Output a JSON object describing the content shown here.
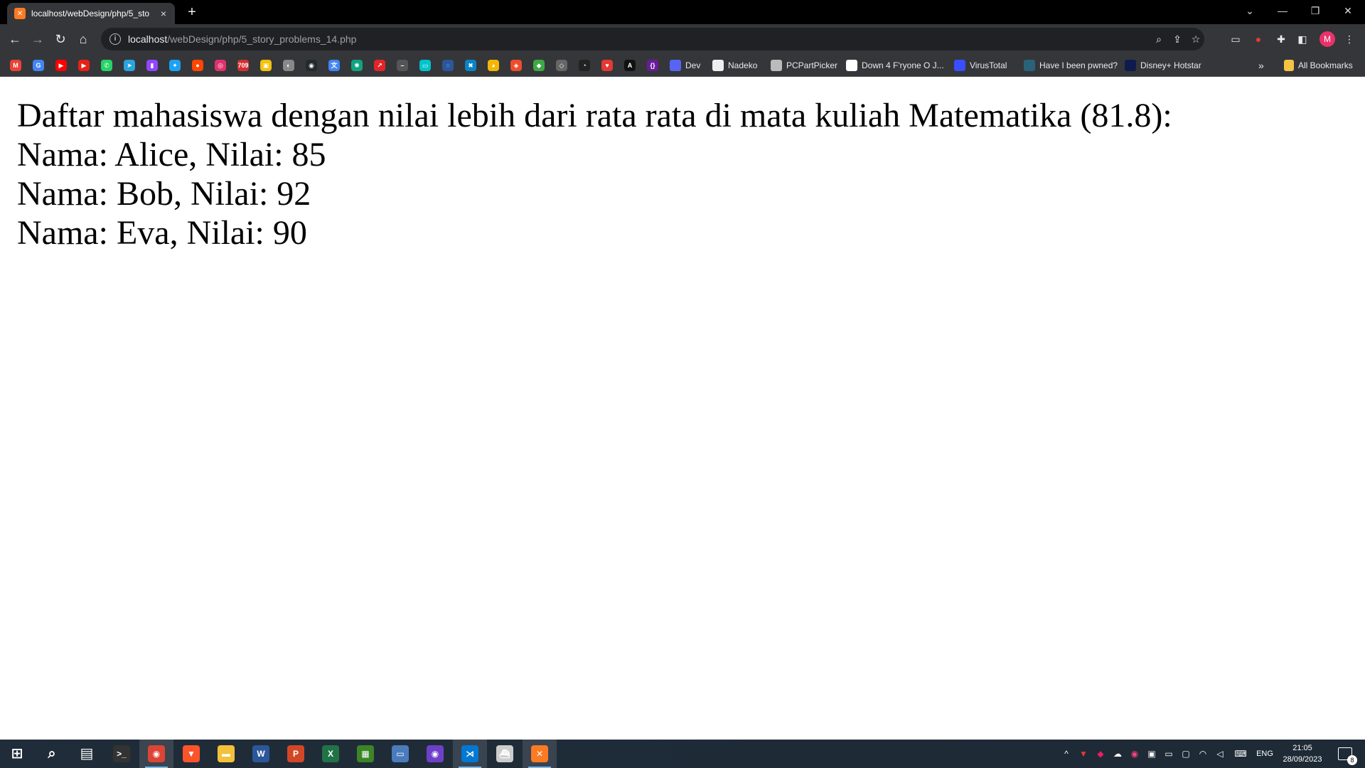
{
  "window": {
    "tab_title": "localhost/webDesign/php/5_sto",
    "tab_close": "×",
    "new_tab": "+",
    "minimize": "—",
    "restore": "❐",
    "close": "✕",
    "tab_search": "⌄"
  },
  "toolbar": {
    "back": "←",
    "forward": "→",
    "reload": "↻",
    "home": "⌂",
    "url_host": "localhost",
    "url_path": "/webDesign/php/5_story_problems_14.php",
    "profile_initial": "M"
  },
  "bookmarks": {
    "icons": [
      {
        "name": "gmail",
        "glyph": "M",
        "color": "#ea4335"
      },
      {
        "name": "google",
        "glyph": "G",
        "color": "#4285f4"
      },
      {
        "name": "youtube",
        "glyph": "▶",
        "color": "#ff0000"
      },
      {
        "name": "youtube-music",
        "glyph": "▶",
        "color": "#e62117"
      },
      {
        "name": "whatsapp",
        "glyph": "✆",
        "color": "#25d366"
      },
      {
        "name": "telegram",
        "glyph": "➤",
        "color": "#2aa3df"
      },
      {
        "name": "twitch",
        "glyph": "▮",
        "color": "#9146ff"
      },
      {
        "name": "twitter",
        "glyph": "✦",
        "color": "#1da1f2"
      },
      {
        "name": "reddit",
        "glyph": "●",
        "color": "#ff4500"
      },
      {
        "name": "instagram",
        "glyph": "◎",
        "color": "#e1306c"
      },
      {
        "name": "1709",
        "glyph": "709",
        "color": "#d32f2f"
      },
      {
        "name": "photo",
        "glyph": "▣",
        "color": "#f4c20d"
      },
      {
        "name": "anime",
        "glyph": "◐",
        "color": "#888888"
      },
      {
        "name": "github",
        "glyph": "◉",
        "color": "#24292e"
      },
      {
        "name": "translate",
        "glyph": "文",
        "color": "#4285f4"
      },
      {
        "name": "chatgpt",
        "glyph": "✺",
        "color": "#10a37f"
      },
      {
        "name": "zoho",
        "glyph": "↗",
        "color": "#e42527"
      },
      {
        "name": "dash",
        "glyph": "–",
        "color": "#555555"
      },
      {
        "name": "canva",
        "glyph": "▭",
        "color": "#00c4cc"
      },
      {
        "name": "quill",
        "glyph": "◌",
        "color": "#2b579a"
      },
      {
        "name": "vscode-web",
        "glyph": "✖",
        "color": "#0a84c6"
      },
      {
        "name": "bear",
        "glyph": "◕",
        "color": "#f2b705"
      },
      {
        "name": "shopping",
        "glyph": "◈",
        "color": "#ee4d2d"
      },
      {
        "name": "mobile-legends",
        "glyph": "◆",
        "color": "#3da944"
      },
      {
        "name": "roblox",
        "glyph": "◇",
        "color": "#666666"
      },
      {
        "name": "speedtest",
        "glyph": "◔",
        "color": "#222222"
      },
      {
        "name": "heart",
        "glyph": "♥",
        "color": "#e53935"
      },
      {
        "name": "bracket-a",
        "glyph": "A",
        "color": "#111111"
      },
      {
        "name": "bracket-b",
        "glyph": "{}",
        "color": "#6a1b9a"
      }
    ],
    "labelled": [
      {
        "name": "dev",
        "label": "Dev",
        "color": "#5865f2"
      },
      {
        "name": "nadeko",
        "label": "Nadeko",
        "color": "#eeeeee"
      },
      {
        "name": "pcpartpicker",
        "label": "PCPartPicker",
        "color": "#bbbbbb"
      },
      {
        "name": "down4",
        "label": "Down 4 F'ryone O J...",
        "color": "#ffffff"
      },
      {
        "name": "virustotal",
        "label": "VirusTotal",
        "color": "#394eff"
      },
      {
        "name": "hibp",
        "label": "Have I been pwned?",
        "color": "#2a6379"
      },
      {
        "name": "hotstar",
        "label": "Disney+ Hotstar",
        "color": "#0f1b4d"
      }
    ],
    "overflow": "»",
    "all_bookmarks": "All Bookmarks"
  },
  "page": {
    "heading": "Daftar mahasiswa dengan nilai lebih dari rata rata di mata kuliah Matematika (81.8):",
    "rows": [
      "Nama: Alice, Nilai: 85",
      "Nama: Bob, Nilai: 92",
      "Nama: Eva, Nilai: 90"
    ]
  },
  "taskbar": {
    "apps": [
      {
        "name": "start",
        "glyph": "⊞",
        "color": "transparent"
      },
      {
        "name": "search",
        "glyph": "⌕",
        "color": "transparent"
      },
      {
        "name": "task-view",
        "glyph": "▤",
        "color": "transparent"
      },
      {
        "name": "terminal",
        "glyph": ">_",
        "color": "#333333"
      },
      {
        "name": "chrome",
        "glyph": "◉",
        "color": "#db4437"
      },
      {
        "name": "brave",
        "glyph": "▼",
        "color": "#fb542b"
      },
      {
        "name": "file-explorer",
        "glyph": "▬",
        "color": "#f3c13a"
      },
      {
        "name": "word",
        "glyph": "W",
        "color": "#2b579a"
      },
      {
        "name": "powerpoint",
        "glyph": "P",
        "color": "#d24726"
      },
      {
        "name": "excel",
        "glyph": "X",
        "color": "#217346"
      },
      {
        "name": "minecraft",
        "glyph": "▦",
        "color": "#3c8527"
      },
      {
        "name": "remote-desktop",
        "glyph": "▭",
        "color": "#4a7bbd"
      },
      {
        "name": "github-desktop",
        "glyph": "◉",
        "color": "#6e40c9"
      },
      {
        "name": "vscode",
        "glyph": "⋊",
        "color": "#0078d4"
      },
      {
        "name": "docker",
        "glyph": "⛴",
        "color": "#cccccc"
      },
      {
        "name": "xampp",
        "glyph": "✕",
        "color": "#fb7a24"
      }
    ],
    "tray": {
      "chevron": "^",
      "language": "ENG",
      "time": "21:05",
      "date": "28/09/2023",
      "notifications": "8"
    }
  }
}
